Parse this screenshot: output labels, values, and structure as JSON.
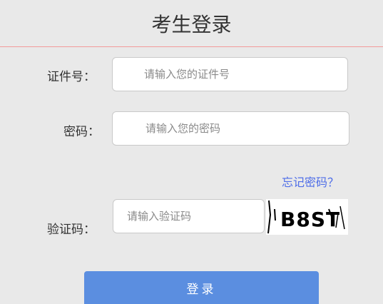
{
  "header": {
    "title": "考生登录"
  },
  "form": {
    "id_label": "证件号：",
    "id_placeholder": "请输入您的证件号",
    "password_label": "密码：",
    "password_placeholder": "请输入您的密码",
    "forgot_password": "忘记密码？",
    "captcha_label": "验证码：",
    "captcha_placeholder": "请输入验证码",
    "captcha_text": "B8ST",
    "login_button": "登录"
  },
  "colors": {
    "background": "#e9e9e9",
    "title_divider": "#f29a9a",
    "link": "#4f6ee8",
    "button": "#5b8ee0"
  }
}
